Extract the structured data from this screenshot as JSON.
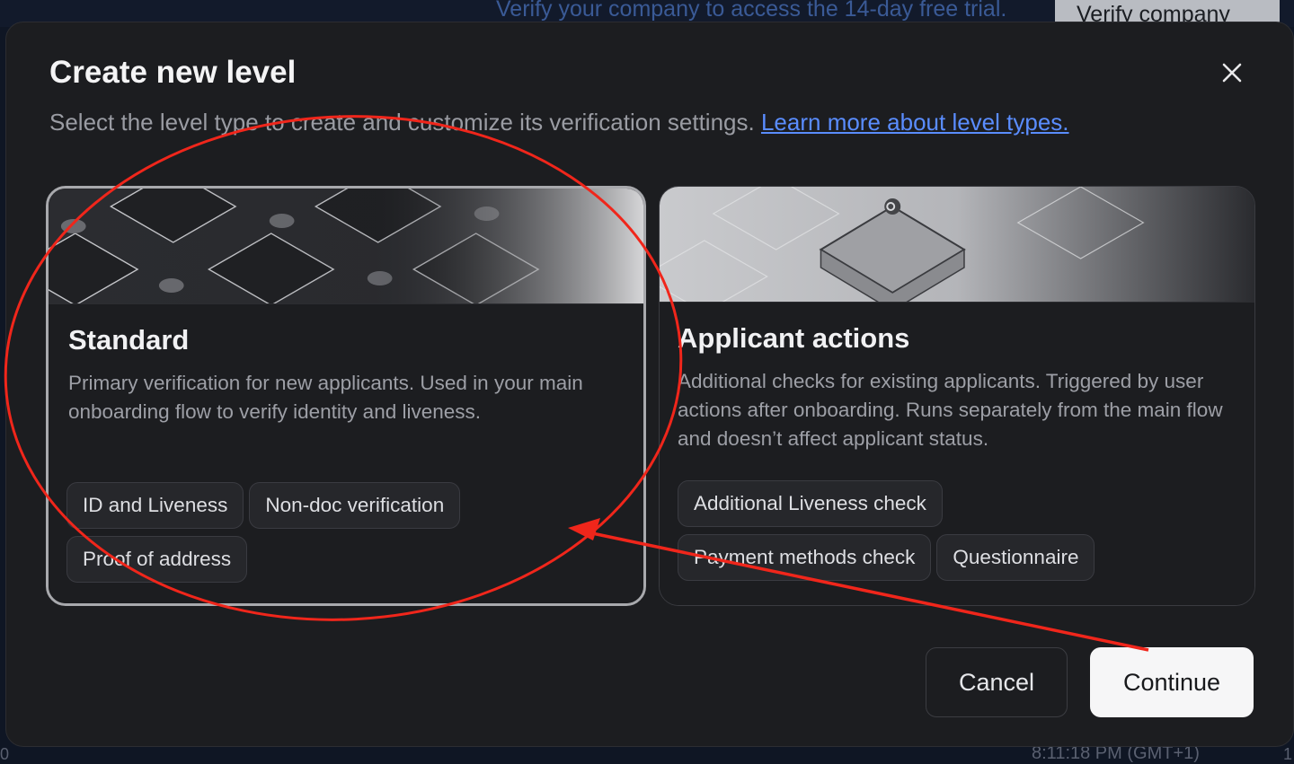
{
  "background": {
    "trial_banner_text": "Verify your company to access the 14-day free trial.",
    "verify_button_label": "Verify company",
    "clock_text": "8:11:18 PM (GMT+1)",
    "edge_left_text": "0",
    "edge_right_text": "1"
  },
  "modal": {
    "title": "Create new level",
    "subtitle": "Select the level type to create and customize its verification settings.",
    "learn_more_link": "Learn more about level types.",
    "close_icon": "close-icon"
  },
  "cards": {
    "standard": {
      "title": "Standard",
      "description": "Primary verification for new applicants. Used in your main onboarding flow to verify identity and liveness.",
      "tags": [
        "ID and Liveness",
        "Non-doc verification",
        "Proof of address"
      ],
      "selected": true
    },
    "applicant_actions": {
      "title": "Applicant actions",
      "description": "Additional checks for existing applicants. Triggered by user actions after onboarding. Runs separately from the main flow and doesn’t affect applicant status.",
      "tags": [
        "Additional Liveness check",
        "Payment methods check",
        "Questionnaire"
      ],
      "selected": false
    }
  },
  "footer": {
    "cancel_label": "Cancel",
    "continue_label": "Continue"
  },
  "colors": {
    "modal_bg": "#1c1d20",
    "link": "#5a8dff",
    "annotation_red": "#f0261b",
    "selected_border": "#a8a9ad"
  }
}
